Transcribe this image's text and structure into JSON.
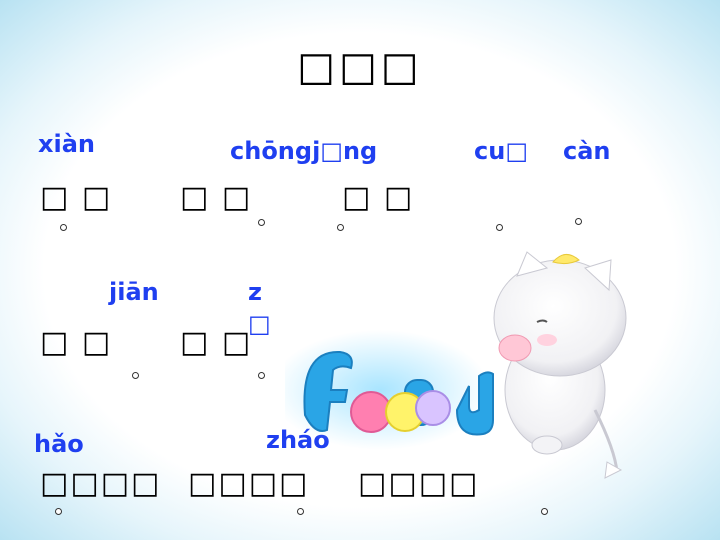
{
  "title": "□□□",
  "pinyin": {
    "p1": "xiàn",
    "p2": "chōngj□ng",
    "p3": "cu□",
    "p4": "càn",
    "p5": "jiān",
    "p6": "z",
    "p6b": "□",
    "p7": "hǎo",
    "p8": "zháo"
  },
  "rows": {
    "r1a": "□ □",
    "r1b": "□ □",
    "r1c": "□ □",
    "r2a": "□ □",
    "r2b": "□ □",
    "r3a": "□□□□",
    "r3b": "□□□□",
    "r3c": "□□□□"
  },
  "icons": {
    "mascot": "white-cat-mascot-illustration",
    "logo": "foody-logo"
  },
  "colors": {
    "pinyin": "#1f3ff0",
    "frame": "#a9dcef"
  }
}
